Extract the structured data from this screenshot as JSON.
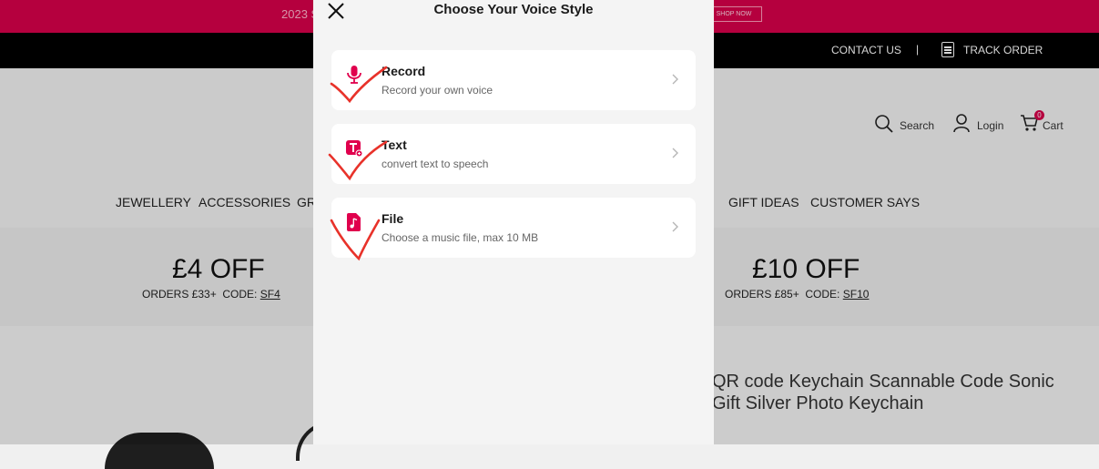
{
  "promo": {
    "text": "2023 S",
    "shop_label": "SHOP NOW"
  },
  "topbar": {
    "contact": "CONTACT US",
    "separator": "|",
    "track": "TRACK ORDER"
  },
  "header": {
    "search": "Search",
    "login": "Login",
    "cart": "Cart",
    "cart_count": "0"
  },
  "nav": {
    "items": [
      "JEWELLERY",
      "ACCESSORIES",
      "GR",
      "GIFT IDEAS",
      "CUSTOMER SAYS"
    ]
  },
  "coupons": [
    {
      "title": "£4 OFF",
      "orders": "ORDERS £33+",
      "code_label": "CODE:",
      "code": "SF4"
    },
    {
      "title": "£10 OFF",
      "orders": "ORDERS £85+",
      "code_label": "CODE:",
      "code": "SF10"
    }
  ],
  "product": {
    "title_line1": "QR code Keychain Scannable Code Sonic",
    "title_line2": "Gift Silver Photo Keychain"
  },
  "modal": {
    "title": "Choose Your Voice Style",
    "options": [
      {
        "title": "Record",
        "subtitle": "Record your own voice",
        "icon": "microphone-icon"
      },
      {
        "title": "Text",
        "subtitle": "convert text to speech",
        "icon": "text-to-speech-icon"
      },
      {
        "title": "File",
        "subtitle": "Choose a music file, max 10 MB",
        "icon": "music-file-icon"
      }
    ]
  },
  "colors": {
    "brand": "#d8004a",
    "icon": "#e0004d",
    "annotation": "#e8322a"
  }
}
